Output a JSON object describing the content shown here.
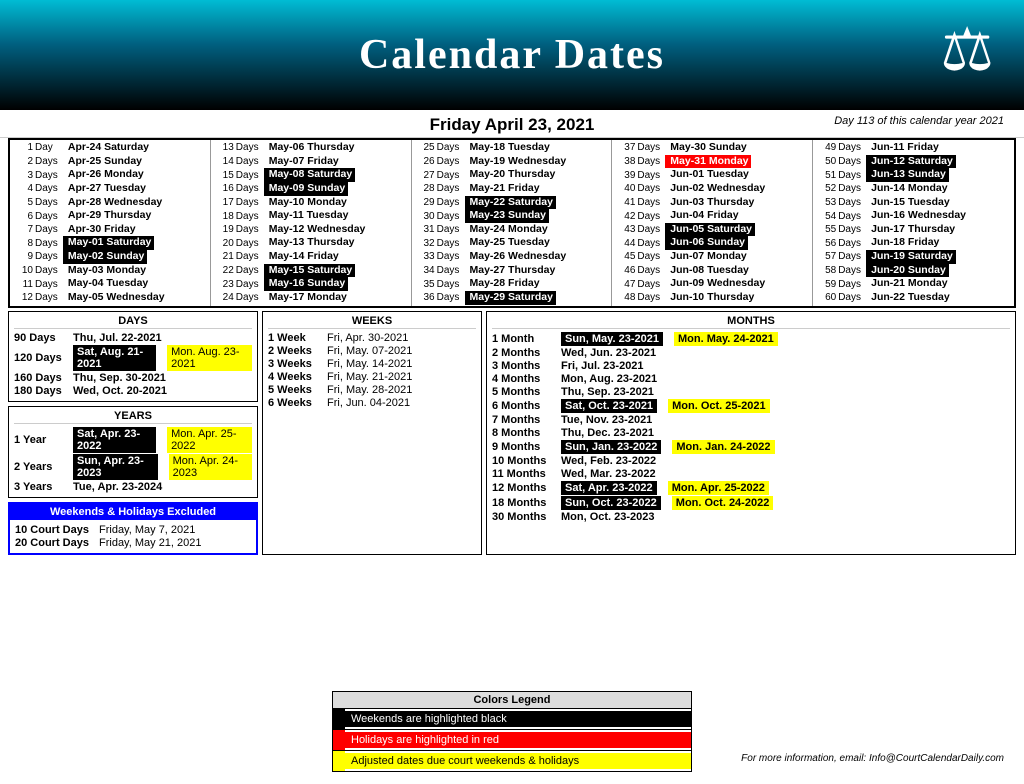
{
  "header": {
    "title": "Calendar Dates",
    "icon": "⚖"
  },
  "datebar": {
    "label": "Friday   April 23, 2021",
    "day_note": "Day 113 of this calendar year 2021"
  },
  "calendar_entries": [
    [
      {
        "num": "1",
        "label": "Day",
        "date": "Apr-24 Saturday",
        "bg": ""
      },
      {
        "num": "2",
        "label": "Days",
        "date": "Apr-25 Sunday",
        "bg": ""
      },
      {
        "num": "3",
        "label": "Days",
        "date": "Apr-26 Monday",
        "bg": ""
      },
      {
        "num": "4",
        "label": "Days",
        "date": "Apr-27 Tuesday",
        "bg": ""
      },
      {
        "num": "5",
        "label": "Days",
        "date": "Apr-28 Wednesday",
        "bg": ""
      },
      {
        "num": "6",
        "label": "Days",
        "date": "Apr-29 Thursday",
        "bg": ""
      },
      {
        "num": "7",
        "label": "Days",
        "date": "Apr-30 Friday",
        "bg": ""
      },
      {
        "num": "8",
        "label": "Days",
        "date": "May-01 Saturday",
        "bg": "black"
      },
      {
        "num": "9",
        "label": "Days",
        "date": "May-02 Sunday",
        "bg": "black"
      },
      {
        "num": "10",
        "label": "Days",
        "date": "May-03 Monday",
        "bg": ""
      },
      {
        "num": "11",
        "label": "Days",
        "date": "May-04 Tuesday",
        "bg": ""
      },
      {
        "num": "12",
        "label": "Days",
        "date": "May-05 Wednesday",
        "bg": ""
      }
    ],
    [
      {
        "num": "13",
        "label": "Days",
        "date": "May-06 Thursday",
        "bg": ""
      },
      {
        "num": "14",
        "label": "Days",
        "date": "May-07 Friday",
        "bg": ""
      },
      {
        "num": "15",
        "label": "Days",
        "date": "May-08 Saturday",
        "bg": "black"
      },
      {
        "num": "16",
        "label": "Days",
        "date": "May-09 Sunday",
        "bg": "black"
      },
      {
        "num": "17",
        "label": "Days",
        "date": "May-10 Monday",
        "bg": ""
      },
      {
        "num": "18",
        "label": "Days",
        "date": "May-11 Tuesday",
        "bg": ""
      },
      {
        "num": "19",
        "label": "Days",
        "date": "May-12 Wednesday",
        "bg": ""
      },
      {
        "num": "20",
        "label": "Days",
        "date": "May-13 Thursday",
        "bg": ""
      },
      {
        "num": "21",
        "label": "Days",
        "date": "May-14 Friday",
        "bg": ""
      },
      {
        "num": "22",
        "label": "Days",
        "date": "May-15 Saturday",
        "bg": "black"
      },
      {
        "num": "23",
        "label": "Days",
        "date": "May-16 Sunday",
        "bg": "black"
      },
      {
        "num": "24",
        "label": "Days",
        "date": "May-17 Monday",
        "bg": ""
      }
    ],
    [
      {
        "num": "25",
        "label": "Days",
        "date": "May-18 Tuesday",
        "bg": ""
      },
      {
        "num": "26",
        "label": "Days",
        "date": "May-19 Wednesday",
        "bg": ""
      },
      {
        "num": "27",
        "label": "Days",
        "date": "May-20 Thursday",
        "bg": ""
      },
      {
        "num": "28",
        "label": "Days",
        "date": "May-21 Friday",
        "bg": ""
      },
      {
        "num": "29",
        "label": "Days",
        "date": "May-22 Saturday",
        "bg": "black"
      },
      {
        "num": "30",
        "label": "Days",
        "date": "May-23 Sunday",
        "bg": "black"
      },
      {
        "num": "31",
        "label": "Days",
        "date": "May-24 Monday",
        "bg": ""
      },
      {
        "num": "32",
        "label": "Days",
        "date": "May-25 Tuesday",
        "bg": ""
      },
      {
        "num": "33",
        "label": "Days",
        "date": "May-26 Wednesday",
        "bg": ""
      },
      {
        "num": "34",
        "label": "Days",
        "date": "May-27 Thursday",
        "bg": ""
      },
      {
        "num": "35",
        "label": "Days",
        "date": "May-28 Friday",
        "bg": ""
      },
      {
        "num": "36",
        "label": "Days",
        "date": "May-29 Saturday",
        "bg": "black"
      }
    ],
    [
      {
        "num": "37",
        "label": "Days",
        "date": "May-30 Sunday",
        "bg": ""
      },
      {
        "num": "38",
        "label": "Days",
        "date": "May-31 Monday",
        "bg": "red"
      },
      {
        "num": "39",
        "label": "Days",
        "date": "Jun-01 Tuesday",
        "bg": ""
      },
      {
        "num": "40",
        "label": "Days",
        "date": "Jun-02 Wednesday",
        "bg": ""
      },
      {
        "num": "41",
        "label": "Days",
        "date": "Jun-03 Thursday",
        "bg": ""
      },
      {
        "num": "42",
        "label": "Days",
        "date": "Jun-04 Friday",
        "bg": ""
      },
      {
        "num": "43",
        "label": "Days",
        "date": "Jun-05 Saturday",
        "bg": "black"
      },
      {
        "num": "44",
        "label": "Days",
        "date": "Jun-06 Sunday",
        "bg": "black"
      },
      {
        "num": "45",
        "label": "Days",
        "date": "Jun-07 Monday",
        "bg": ""
      },
      {
        "num": "46",
        "label": "Days",
        "date": "Jun-08 Tuesday",
        "bg": ""
      },
      {
        "num": "47",
        "label": "Days",
        "date": "Jun-09 Wednesday",
        "bg": ""
      },
      {
        "num": "48",
        "label": "Days",
        "date": "Jun-10 Thursday",
        "bg": ""
      }
    ],
    [
      {
        "num": "49",
        "label": "Days",
        "date": "Jun-11 Friday",
        "bg": ""
      },
      {
        "num": "50",
        "label": "Days",
        "date": "Jun-12 Saturday",
        "bg": "black"
      },
      {
        "num": "51",
        "label": "Days",
        "date": "Jun-13 Sunday",
        "bg": "black"
      },
      {
        "num": "52",
        "label": "Days",
        "date": "Jun-14 Monday",
        "bg": ""
      },
      {
        "num": "53",
        "label": "Days",
        "date": "Jun-15 Tuesday",
        "bg": ""
      },
      {
        "num": "54",
        "label": "Days",
        "date": "Jun-16 Wednesday",
        "bg": ""
      },
      {
        "num": "55",
        "label": "Days",
        "date": "Jun-17 Thursday",
        "bg": ""
      },
      {
        "num": "56",
        "label": "Days",
        "date": "Jun-18 Friday",
        "bg": ""
      },
      {
        "num": "57",
        "label": "Days",
        "date": "Jun-19 Saturday",
        "bg": "black"
      },
      {
        "num": "58",
        "label": "Days",
        "date": "Jun-20 Sunday",
        "bg": "black"
      },
      {
        "num": "59",
        "label": "Days",
        "date": "Jun-21 Monday",
        "bg": ""
      },
      {
        "num": "60",
        "label": "Days",
        "date": "Jun-22 Tuesday",
        "bg": ""
      }
    ]
  ],
  "days_section": {
    "title": "DAYS",
    "rows": [
      {
        "num": "90",
        "label": "Days",
        "date": "Thu, Jul. 22-2021",
        "adj": ""
      },
      {
        "num": "120",
        "label": "Days",
        "date": "Sat, Aug. 21-2021",
        "adj": "Mon. Aug. 23-2021"
      },
      {
        "num": "160",
        "label": "Days",
        "date": "Thu, Sep. 30-2021",
        "adj": ""
      },
      {
        "num": "180",
        "label": "Days",
        "date": "Wed, Oct. 20-2021",
        "adj": ""
      }
    ]
  },
  "years_section": {
    "title": "YEARS",
    "rows": [
      {
        "num": "1",
        "label": "Year",
        "date": "Sat, Apr. 23-2022",
        "adj": "Mon. Apr. 25-2022"
      },
      {
        "num": "2",
        "label": "Years",
        "date": "Sun, Apr. 23-2023",
        "adj": "Mon. Apr. 24-2023"
      },
      {
        "num": "3",
        "label": "Years",
        "date": "Tue, Apr. 23-2024",
        "adj": ""
      }
    ]
  },
  "court_section": {
    "title": "Weekends & Holidays Excluded",
    "rows": [
      {
        "label": "10 Court Days",
        "date": "Friday, May 7, 2021"
      },
      {
        "label": "20 Court Days",
        "date": "Friday, May 21, 2021"
      }
    ]
  },
  "weeks_section": {
    "title": "WEEKS",
    "rows": [
      {
        "num": "1",
        "label": "Week",
        "date": "Fri, Apr. 30-2021"
      },
      {
        "num": "2",
        "label": "Weeks",
        "date": "Fri, May. 07-2021"
      },
      {
        "num": "3",
        "label": "Weeks",
        "date": "Fri, May. 14-2021"
      },
      {
        "num": "4",
        "label": "Weeks",
        "date": "Fri, May. 21-2021"
      },
      {
        "num": "5",
        "label": "Weeks",
        "date": "Fri, May. 28-2021"
      },
      {
        "num": "6",
        "label": "Weeks",
        "date": "Fri, Jun. 04-2021"
      }
    ]
  },
  "months_section": {
    "title": "MONTHS",
    "rows": [
      {
        "num": "1",
        "label": "Month",
        "date": "Sun, May. 23-2021",
        "adj": "Mon. May. 24-2021"
      },
      {
        "num": "2",
        "label": "Months",
        "date": "Wed, Jun. 23-2021",
        "adj": ""
      },
      {
        "num": "3",
        "label": "Months",
        "date": "Fri, Jul. 23-2021",
        "adj": ""
      },
      {
        "num": "4",
        "label": "Months",
        "date": "Mon, Aug. 23-2021",
        "adj": ""
      },
      {
        "num": "5",
        "label": "Months",
        "date": "Thu, Sep. 23-2021",
        "adj": ""
      },
      {
        "num": "6",
        "label": "Months",
        "date": "Sat, Oct. 23-2021",
        "adj": "Mon. Oct. 25-2021"
      },
      {
        "num": "7",
        "label": "Months",
        "date": "Tue, Nov. 23-2021",
        "adj": ""
      },
      {
        "num": "8",
        "label": "Months",
        "date": "Thu, Dec. 23-2021",
        "adj": ""
      },
      {
        "num": "9",
        "label": "Months",
        "date": "Sun, Jan. 23-2022",
        "adj": "Mon. Jan. 24-2022"
      },
      {
        "num": "10",
        "label": "Months",
        "date": "Wed, Feb. 23-2022",
        "adj": ""
      },
      {
        "num": "11",
        "label": "Months",
        "date": "Wed, Mar. 23-2022",
        "adj": ""
      },
      {
        "num": "12",
        "label": "Months",
        "date": "Sat, Apr. 23-2022",
        "adj": "Mon. Apr. 25-2022"
      },
      {
        "num": "18",
        "label": "Months",
        "date": "Sun, Oct. 23-2022",
        "adj": "Mon. Oct. 24-2022"
      },
      {
        "num": "30",
        "label": "Months",
        "date": "Mon, Oct. 23-2023",
        "adj": ""
      }
    ]
  },
  "legend": {
    "title": "Colors Legend",
    "rows": [
      {
        "color": "#000000",
        "text": "Weekends are highlighted black",
        "text_color": "#fff"
      },
      {
        "color": "#ff0000",
        "text": "Holidays are highlighted in red",
        "text_color": "#fff"
      },
      {
        "color": "#ffff00",
        "text": "Adjusted dates due court weekends & holidays",
        "text_color": "#000"
      }
    ]
  },
  "footer": {
    "email": "For more information, email: Info@CourtCalendarDaily.com"
  }
}
